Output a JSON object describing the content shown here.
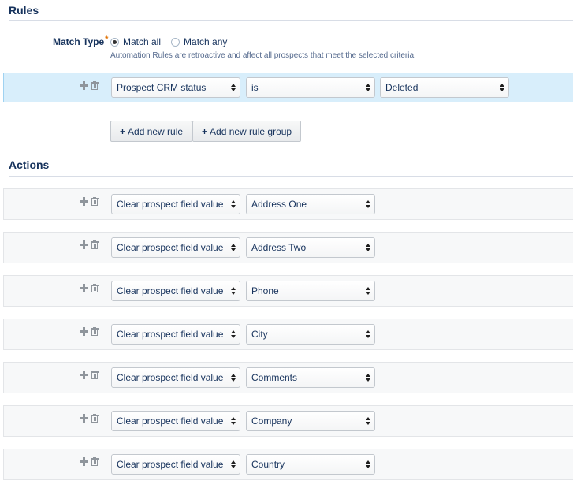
{
  "rules": {
    "title": "Rules",
    "match_type": {
      "label": "Match Type",
      "required_mark": "*",
      "options": [
        {
          "label": "Match all",
          "checked": true
        },
        {
          "label": "Match any",
          "checked": false
        }
      ],
      "help": "Automation Rules are retroactive and affect all prospects that meet the selected criteria."
    },
    "rule": {
      "field": "Prospect CRM status",
      "operator": "is",
      "value": "Deleted"
    },
    "buttons": {
      "add_rule_icon": "+",
      "add_rule": "Add new rule",
      "add_group_icon": "+",
      "add_group": "Add new rule group"
    }
  },
  "actions": {
    "title": "Actions",
    "items": [
      {
        "action": "Clear prospect field value",
        "field": "Address One"
      },
      {
        "action": "Clear prospect field value",
        "field": "Address Two"
      },
      {
        "action": "Clear prospect field value",
        "field": "Phone"
      },
      {
        "action": "Clear prospect field value",
        "field": "City"
      },
      {
        "action": "Clear prospect field value",
        "field": "Comments"
      },
      {
        "action": "Clear prospect field value",
        "field": "Company"
      },
      {
        "action": "Clear prospect field value",
        "field": "Country"
      }
    ]
  },
  "icons": {
    "add": "plus-icon",
    "delete": "trash-icon",
    "select": "select-arrows-icon"
  },
  "colors": {
    "highlight_row": "#d8eefb",
    "text": "#16325c",
    "required": "#e07000"
  }
}
